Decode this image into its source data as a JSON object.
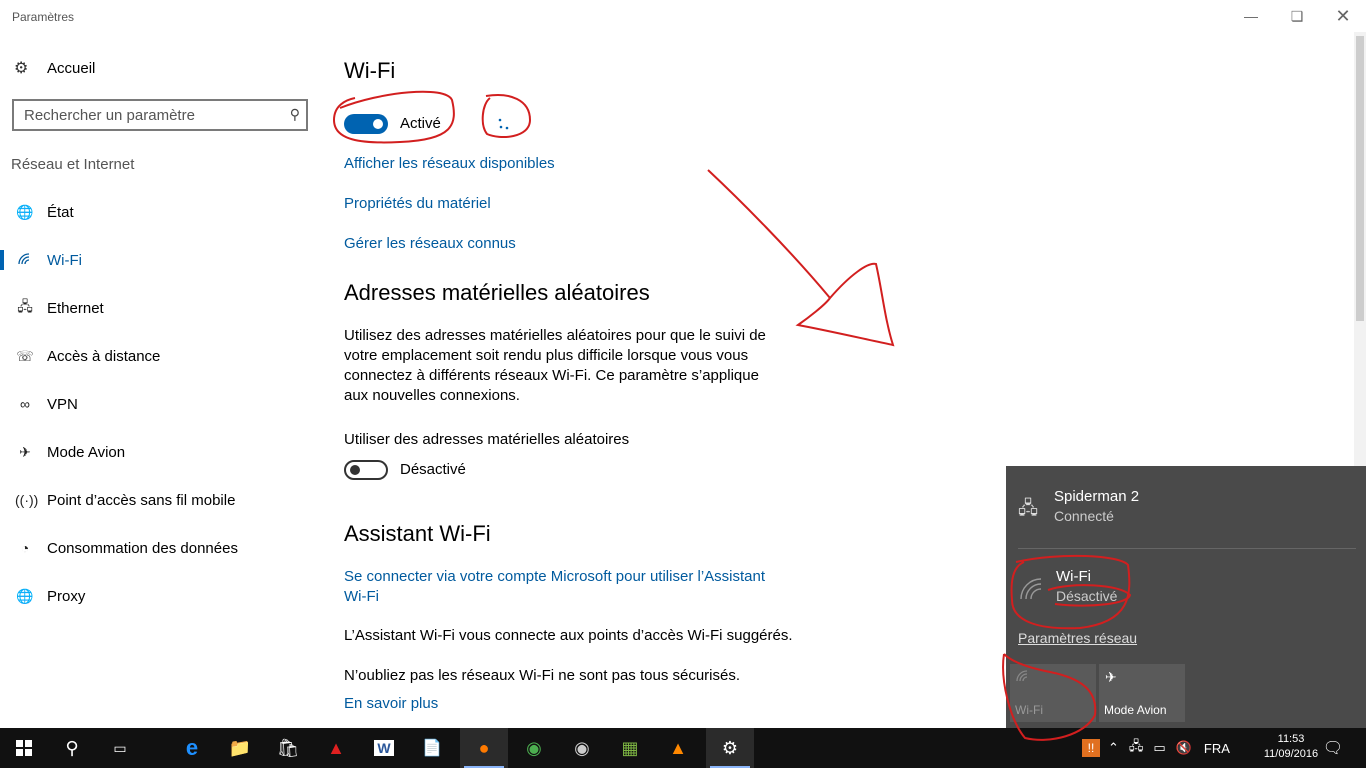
{
  "window": {
    "title": "Paramètres",
    "minimize_icon": "minimize-icon",
    "restore_icon": "restore-icon",
    "close_icon": "close-icon"
  },
  "sidebar": {
    "home_label": "Accueil",
    "search_placeholder": "Rechercher un paramètre",
    "section_title": "Réseau et Internet",
    "items": [
      {
        "label": "État",
        "icon": "globe-icon"
      },
      {
        "label": "Wi-Fi",
        "icon": "wifi-icon",
        "active": true
      },
      {
        "label": "Ethernet",
        "icon": "ethernet-icon"
      },
      {
        "label": "Accès à distance",
        "icon": "dialup-icon"
      },
      {
        "label": "VPN",
        "icon": "vpn-icon"
      },
      {
        "label": "Mode Avion",
        "icon": "airplane-icon"
      },
      {
        "label": "Point d’accès sans fil mobile",
        "icon": "hotspot-icon"
      },
      {
        "label": "Consommation des données",
        "icon": "data-usage-icon"
      },
      {
        "label": "Proxy",
        "icon": "proxy-globe-icon"
      }
    ]
  },
  "main": {
    "title": "Wi-Fi",
    "wifi_toggle_label": "Activé",
    "links": [
      "Afficher les réseaux disponibles",
      "Propriétés du matériel",
      "Gérer les réseaux connus"
    ],
    "random": {
      "title": "Adresses matérielles aléatoires",
      "description": "Utilisez des adresses matérielles aléatoires pour que le suivi de votre emplacement soit rendu plus difficile lorsque vous vous connectez à différents réseaux Wi-Fi. Ce paramètre s’applique aux nouvelles connexions.",
      "setting_label": "Utiliser des adresses matérielles aléatoires",
      "toggle_label": "Désactivé"
    },
    "assistant": {
      "title": "Assistant Wi-Fi",
      "connect_link": "Se connecter via votre compte Microsoft pour utiliser l’Assistant Wi-Fi",
      "text1": "L’Assistant Wi-Fi vous connecte aux points d’accès Wi-Fi suggérés.",
      "text2": "N’oubliez pas les réseaux Wi-Fi ne sont pas tous sécurisés.",
      "learn_more": "En savoir plus"
    }
  },
  "flyout": {
    "network_name": "Spiderman  2",
    "network_status": "Connecté",
    "wifi_title": "Wi-Fi",
    "wifi_status": "Désactivé",
    "settings_link": "Paramètres réseau",
    "tiles": [
      {
        "label": "Wi-Fi",
        "icon": "wifi-icon"
      },
      {
        "label": "Mode Avion",
        "icon": "airplane-icon"
      }
    ]
  },
  "taskbar": {
    "language": "FRA",
    "time": "11:53",
    "date": "11/09/2016",
    "apps": [
      "edge-icon",
      "file-explorer-icon",
      "store-icon",
      "acrobat-icon",
      "word-icon",
      "notepad-icon",
      "firefox-icon",
      "chrome-icon",
      "camera-app-icon",
      "bluestacks-icon",
      "vlc-icon",
      "settings-gear-icon"
    ]
  },
  "colors": {
    "accent": "#0063b1",
    "link": "#005a9e",
    "flyout_bg": "#4a4a4a",
    "taskbar_bg": "#111111",
    "annotation": "#d21f1f"
  }
}
